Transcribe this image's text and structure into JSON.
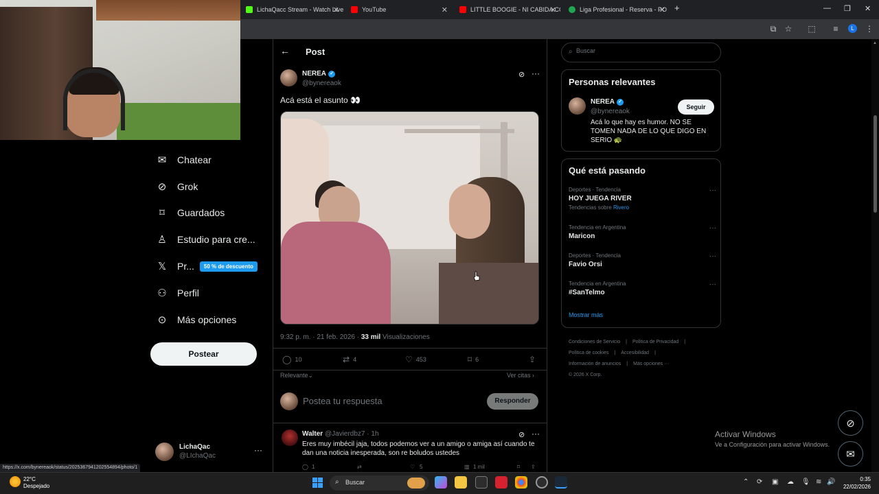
{
  "browser": {
    "tabs": [
      {
        "label": "LichaQacc Stream - Watch Live",
        "color": "#53fc18"
      },
      {
        "label": "YouTube",
        "color": "#ff0000"
      },
      {
        "label": "LITTLE BOOGIE - NI CABIDA CO",
        "color": "#ff0000"
      },
      {
        "label": "Liga Profesional - Reserva - PO",
        "color": "#1fa84f"
      }
    ],
    "new_tab": "+",
    "profile_initial": "L"
  },
  "nav": {
    "items": [
      {
        "label": "Chatear",
        "icon": "mail-icon"
      },
      {
        "label": "Grok",
        "icon": "grok-icon"
      },
      {
        "label": "Guardados",
        "icon": "bookmark-icon"
      },
      {
        "label": "Estudio para cre...",
        "icon": "studio-icon"
      },
      {
        "label": "Pr...",
        "icon": "x-logo-icon",
        "badge": "50 % de descuento"
      },
      {
        "label": "Perfil",
        "icon": "person-icon"
      },
      {
        "label": "Más opciones",
        "icon": "more-circle-icon"
      }
    ],
    "post_button": "Postear",
    "me": {
      "name": "LichaQac",
      "handle": "@LIchaQac"
    }
  },
  "status_url": "https://x.com/bynereaok/status/2025367941202554894/photo/1",
  "post": {
    "header_title": "Post",
    "author_name": "NEREA",
    "author_handle": "@bynereaok",
    "text": "Acá está el asunto 👀",
    "meta_time": "9:32 p. m. · 21 feb. 2026 · ",
    "meta_views_count": "33 mil",
    "meta_views_label": " Visualizaciones",
    "actions": {
      "replies": "10",
      "reposts": "4",
      "likes": "453",
      "bookmarks": "6"
    },
    "sort_label": "Relevante",
    "quotes_label": "Ver citas",
    "reply_placeholder": "Postea tu respuesta",
    "reply_button": "Responder"
  },
  "comment": {
    "name": "Walter",
    "handle": "@Javierdbz7",
    "time": "· 1h",
    "text": "Eres muy imbécil jaja, todos podemos ver a un amigo o amiga así cuando te dan una noticia inesperada, son re boludos ustedes",
    "replies": "1",
    "likes": "5",
    "views": "1 mil"
  },
  "sidebar": {
    "search_placeholder": "Buscar",
    "relevant": {
      "title": "Personas relevantes",
      "name": "NEREA",
      "handle": "@bynereaok",
      "follow": "Seguir",
      "bio": "Acá lo que hay es humor. NO SE TOMEN NADA DE LO QUE DIGO EN SERIO 🐢"
    },
    "trends_title": "Qué está pasando",
    "trends": [
      {
        "context": "Deportes · Tendencia",
        "name": "HOY JUEGA RIVER",
        "sub_prefix": "Tendencias sobre ",
        "sub_link": "Rivero"
      },
      {
        "context": "Tendencia en Argentina",
        "name": "Maricon"
      },
      {
        "context": "Deportes · Tendencia",
        "name": "Favio Orsi"
      },
      {
        "context": "Tendencia en Argentina",
        "name": "#SanTelmo"
      }
    ],
    "show_more": "Mostrar más",
    "footer": [
      "Condiciones de Servicio",
      "|",
      "Política de Privacidad",
      "|",
      "Política de cookies",
      "|",
      "Accesibilidad",
      "|",
      "Información de anuncios",
      "|",
      "Más opciones ···",
      "© 2026 X Corp."
    ]
  },
  "windows": {
    "activate_title": "Activar Windows",
    "activate_sub": "Ve a Configuración para activar Windows."
  },
  "taskbar": {
    "temp": "22°C",
    "weather": "Despejado",
    "search": "Buscar",
    "time": "0:35",
    "date": "22/02/2026"
  }
}
